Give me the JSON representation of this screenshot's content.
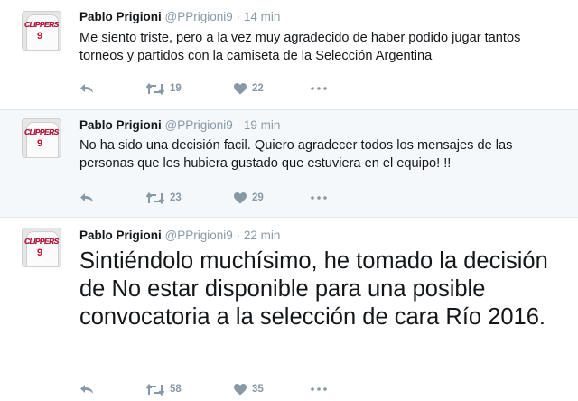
{
  "colors": {
    "text": "#14171a",
    "muted": "#8899a6",
    "highlight_bg": "#f5f8fa",
    "separator": "#e1e8ed"
  },
  "avatar": {
    "wordmark": "CLIPPERS",
    "number": "9"
  },
  "tweets": [
    {
      "name": "Pablo Prigioni",
      "handle": "@PPrigioni9",
      "separator": "·",
      "time": "14 min",
      "text": "Me siento triste,  pero a la vez muy agradecido de haber podido jugar tantos torneos y partidos con la camiseta de la Selección Argentina",
      "retweets": "19",
      "likes": "22"
    },
    {
      "name": "Pablo Prigioni",
      "handle": "@PPrigioni9",
      "separator": "·",
      "time": "19 min",
      "text": "No ha sido una decisión facil. Quiero agradecer todos los mensajes de las personas que les hubiera gustado que estuviera en el equipo! !!",
      "retweets": "23",
      "likes": "29"
    },
    {
      "name": "Pablo Prigioni",
      "handle": "@PPrigioni9",
      "separator": "·",
      "time": "22 min",
      "text": "Sintiéndolo muchísimo, he tomado la decisión de No estar disponible para una posible convocatoria a la selección de cara  Río 2016.",
      "retweets": "58",
      "likes": "35"
    }
  ],
  "icons": {
    "reply": "reply-icon",
    "retweet": "retweet-icon",
    "like": "heart-icon",
    "more": "more-dots-icon"
  }
}
